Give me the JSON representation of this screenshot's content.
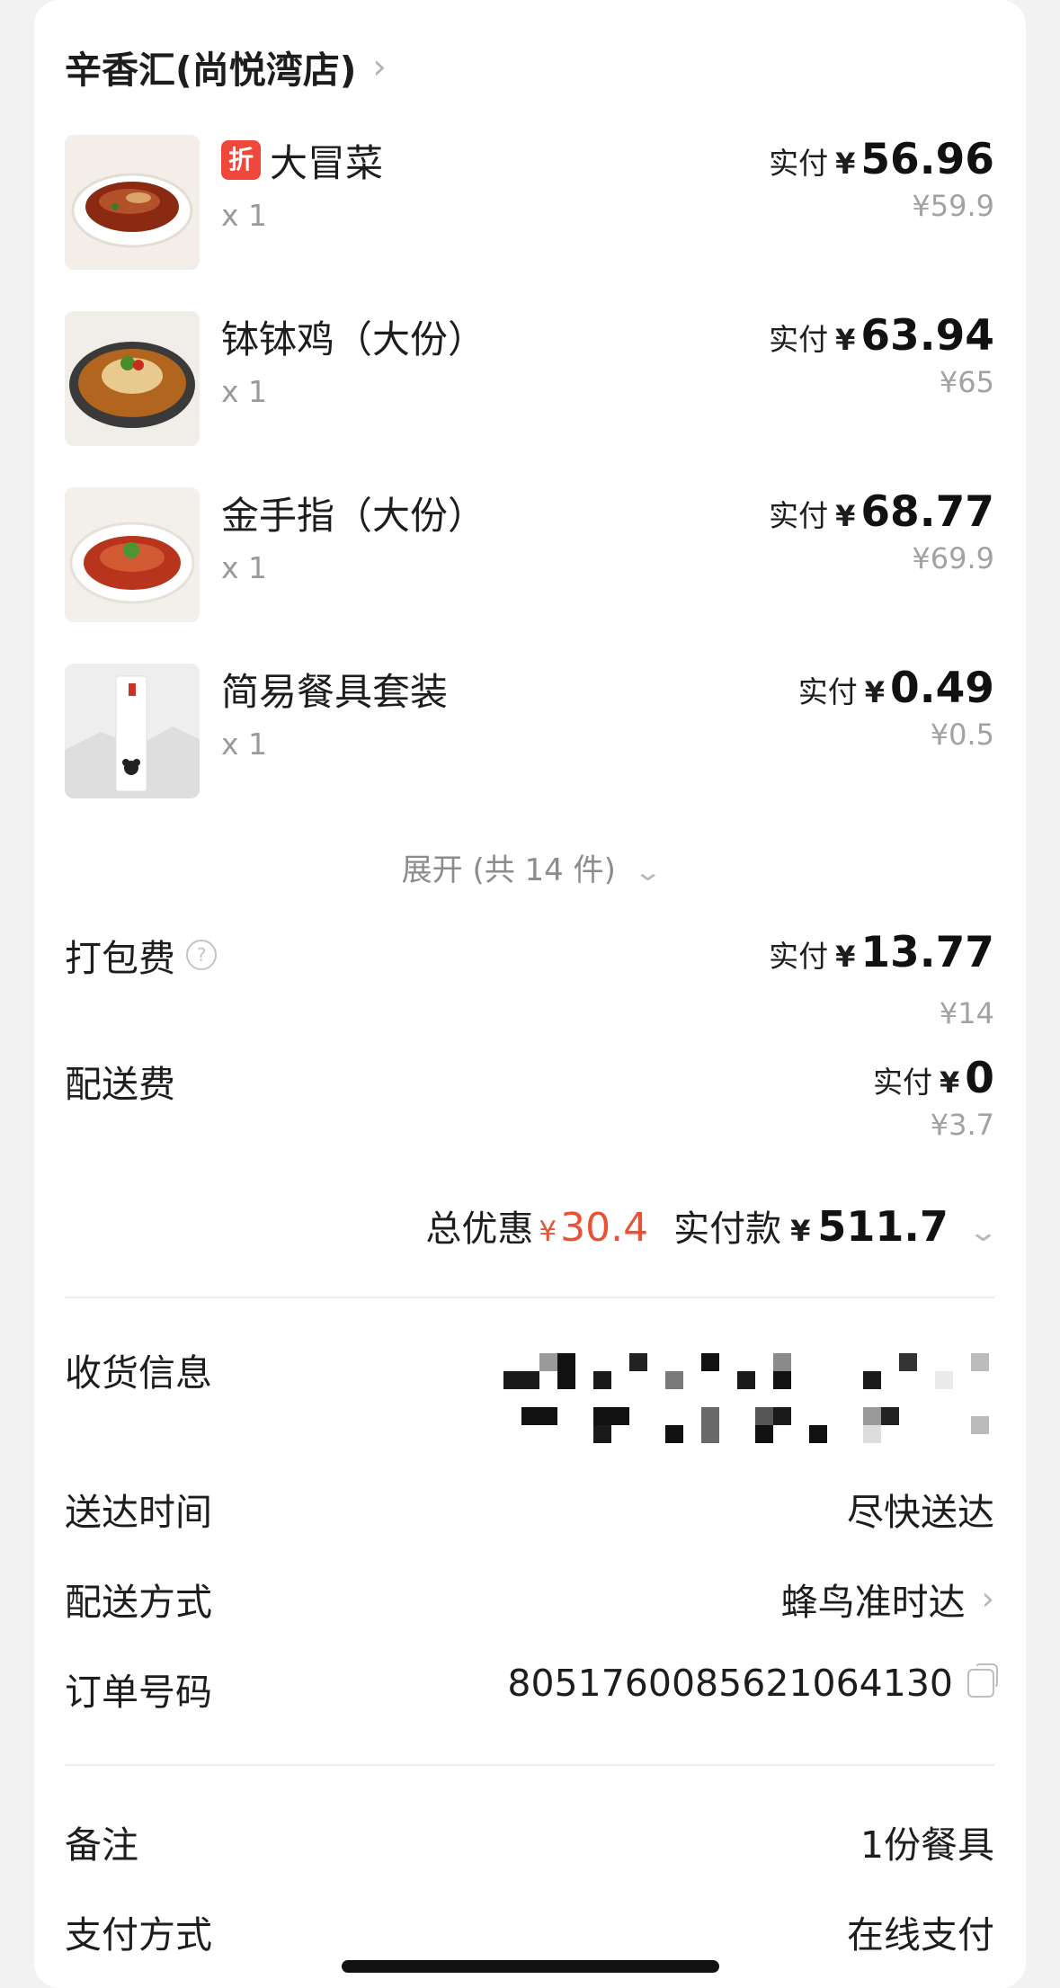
{
  "shop": {
    "name": "辛香汇(尚悦湾店)",
    "chevron": "›"
  },
  "items": [
    {
      "tag": "折",
      "name": "大冒菜",
      "qty": "x 1",
      "pay_label": "实付",
      "currency": "¥",
      "amount": "56.96",
      "original": "¥59.9",
      "icon": "dish-maocai-image"
    },
    {
      "tag": "",
      "name": "钵钵鸡（大份）",
      "qty": "x 1",
      "pay_label": "实付",
      "currency": "¥",
      "amount": "63.94",
      "original": "¥65",
      "icon": "dish-bobo-chicken-image"
    },
    {
      "tag": "",
      "name": "金手指（大份）",
      "qty": "x 1",
      "pay_label": "实付",
      "currency": "¥",
      "amount": "68.77",
      "original": "¥69.9",
      "icon": "dish-golden-finger-image"
    },
    {
      "tag": "",
      "name": "简易餐具套装",
      "qty": "x 1",
      "pay_label": "实付",
      "currency": "¥",
      "amount": "0.49",
      "original": "¥0.5",
      "icon": "tableware-set-image"
    }
  ],
  "expand": {
    "label": "展开 (共 14 件)",
    "chevron": "⌄"
  },
  "fees": {
    "packing": {
      "label": "打包费",
      "help": "?",
      "pay_label": "实付",
      "currency": "¥",
      "amount": "13.77",
      "original": "¥14"
    },
    "delivery": {
      "label": "配送费",
      "pay_label": "实付",
      "currency": "¥",
      "amount": "0",
      "original": "¥3.7"
    }
  },
  "summary": {
    "discount_label": "总优惠",
    "discount_currency": "¥",
    "discount_amount": "30.4",
    "paid_label": "实付款",
    "paid_currency": "¥",
    "paid_amount": "511.7",
    "chevron": "⌄"
  },
  "info": {
    "address": {
      "label": "收货信息"
    },
    "time": {
      "label": "送达时间",
      "value": "尽快送达"
    },
    "method": {
      "label": "配送方式",
      "value": "蜂鸟准时达",
      "chevron": "›"
    },
    "order": {
      "label": "订单号码",
      "value": "8051760085621064130"
    },
    "note": {
      "label": "备注",
      "value": "1份餐具"
    },
    "payment": {
      "label": "支付方式",
      "value": "在线支付"
    }
  },
  "colors": {
    "accent_red": "#e95335",
    "tag_red": "#f0473b",
    "muted": "#a2a2a2"
  }
}
